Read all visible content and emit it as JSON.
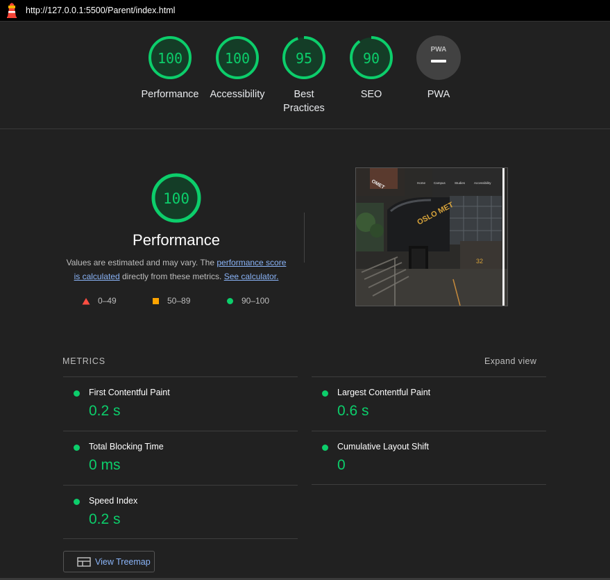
{
  "url": "http://127.0.0.1:5500/Parent/index.html",
  "colors": {
    "pass": "#0cce6b",
    "average": "#ffa400",
    "fail": "#ff4e42",
    "pwa_bg": "#424242"
  },
  "scores": [
    {
      "value": "100",
      "label": "Performance",
      "percent": 100
    },
    {
      "value": "100",
      "label": "Accessibility",
      "percent": 100
    },
    {
      "value": "95",
      "label": "Best Practices",
      "percent": 95
    },
    {
      "value": "90",
      "label": "SEO",
      "percent": 90
    },
    {
      "value": "PWA",
      "label": "PWA",
      "icon": "pwa-dash-icon"
    }
  ],
  "performance": {
    "score": "100",
    "title": "Performance",
    "desc_pre": "Values are estimated and may vary. The ",
    "desc_link1": "performance score is calculated",
    "desc_mid": " directly from these metrics. ",
    "desc_link2": "See calculator.",
    "legend": [
      {
        "icon": "triangle-fail-icon",
        "label": "0–49"
      },
      {
        "icon": "square-average-icon",
        "label": "50–89"
      },
      {
        "icon": "circle-pass-icon",
        "label": "90–100"
      }
    ]
  },
  "screenshot": {
    "nav": [
      "Home",
      "Campus",
      "Studies",
      "Accessibility"
    ],
    "sign": "OSLO MET",
    "logo": "OMET",
    "number": "32"
  },
  "metrics": {
    "heading": "METRICS",
    "expand": "Expand view",
    "items": [
      {
        "name": "First Contentful Paint",
        "value": "0.2 s"
      },
      {
        "name": "Largest Contentful Paint",
        "value": "0.6 s"
      },
      {
        "name": "Total Blocking Time",
        "value": "0 ms"
      },
      {
        "name": "Cumulative Layout Shift",
        "value": "0"
      },
      {
        "name": "Speed Index",
        "value": "0.2 s"
      }
    ]
  },
  "treemap_button": "View Treemap"
}
